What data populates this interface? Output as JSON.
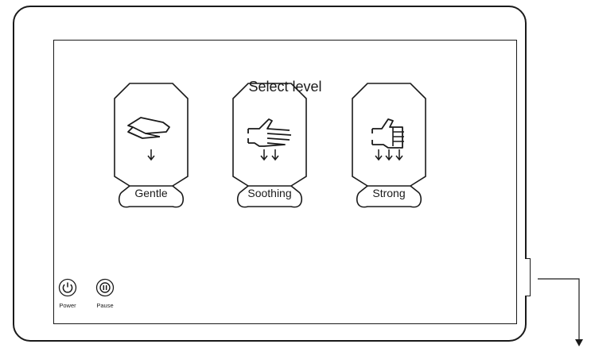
{
  "screen": {
    "title": "Select level"
  },
  "levels": [
    {
      "label": "Gentle",
      "icon": "open-hand-icon",
      "arrows": 1
    },
    {
      "label": "Soothing",
      "icon": "spread-hand-icon",
      "arrows": 2
    },
    {
      "label": "Strong",
      "icon": "fist-icon",
      "arrows": 3
    }
  ],
  "controls": {
    "power_label": "Power",
    "pause_label": "Pause"
  },
  "colors": {
    "stroke": "#1a1a1a",
    "background": "#ffffff"
  }
}
